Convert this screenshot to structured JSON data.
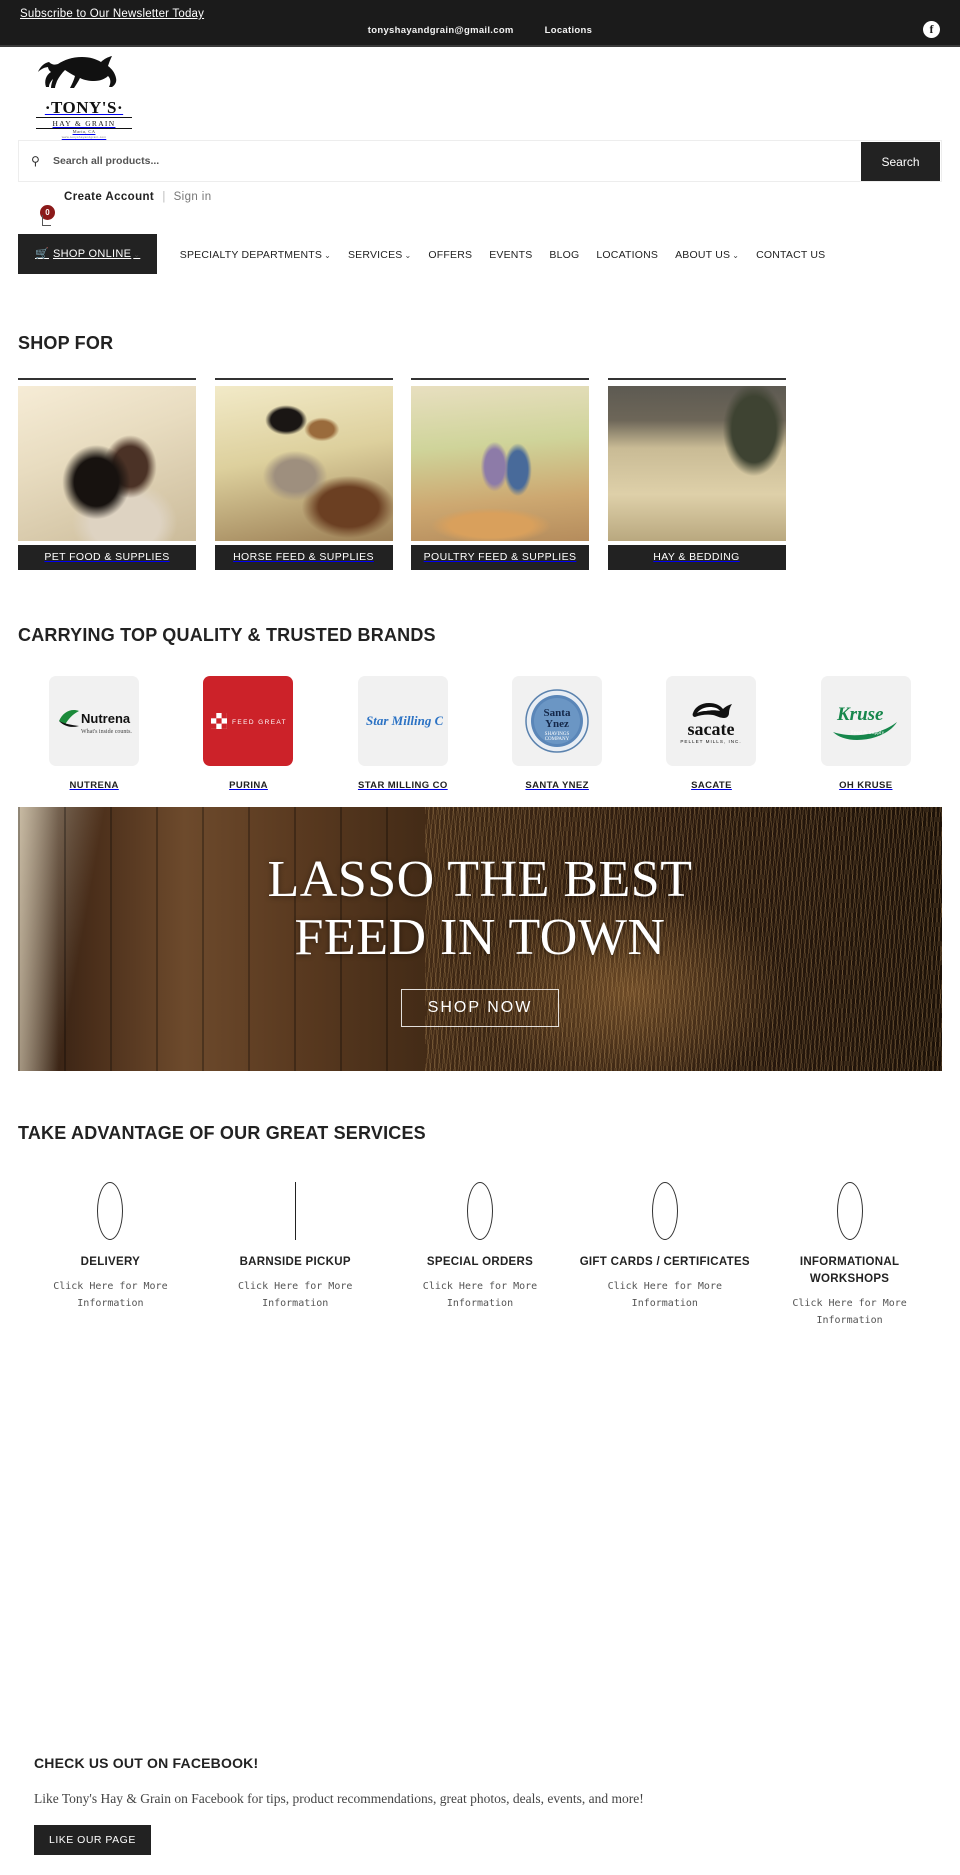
{
  "topbar": {
    "newsletter": "Subscribe to Our Newsletter Today",
    "email": "tonyshayandgrain@gmail.com",
    "locations": "Locations",
    "facebook_icon": "facebook-icon",
    "facebook_glyph": "f"
  },
  "logo": {
    "name": "·TONY'S·",
    "sub": "HAY & GRAIN",
    "city": "Maria, CA",
    "url": "www.tonyshayandgrain.com"
  },
  "search": {
    "placeholder": "Search all products...",
    "value": "",
    "button": "Search",
    "icon": "search-icon"
  },
  "account": {
    "create": "Create Account",
    "separator": "|",
    "signin": "Sign in",
    "cart_count": "0"
  },
  "nav": {
    "primary": {
      "label": "SHOP ONLINE",
      "caret": "⌄",
      "icon": "cart-icon"
    },
    "items": [
      {
        "label": "SPECIALTY DEPARTMENTS",
        "caret": "⌄"
      },
      {
        "label": "SERVICES",
        "caret": "⌄"
      },
      {
        "label": "OFFERS",
        "caret": ""
      },
      {
        "label": "EVENTS",
        "caret": ""
      },
      {
        "label": "BLOG",
        "caret": ""
      },
      {
        "label": "LOCATIONS",
        "caret": ""
      },
      {
        "label": "ABOUT US",
        "caret": "⌄"
      },
      {
        "label": "CONTACT US",
        "caret": ""
      }
    ]
  },
  "shop_for": {
    "heading": "SHOP FOR",
    "cards": [
      {
        "label": "PET FOOD & SUPPLIES",
        "image": "man-hugging-border-collie-dog"
      },
      {
        "label": "HORSE FEED & SUPPLIES",
        "image": "two-riders-on-horseback-in-cowboy-hats"
      },
      {
        "label": "POULTRY FEED & SUPPLIES",
        "image": "two-girls-feeding-chickens"
      },
      {
        "label": "HAY & BEDDING",
        "image": "person-stacking-hay-bales-in-barn"
      }
    ]
  },
  "brands": {
    "heading": "CARRYING TOP QUALITY & TRUSTED BRANDS",
    "items": [
      {
        "name": "NUTRENA",
        "logo_text": "Nutrena",
        "logo_tag": "What's inside counts.",
        "color": "#111111"
      },
      {
        "name": "PURINA",
        "logo_text": "FEED GREATNESS",
        "logo_tag": "",
        "color": "#cc2229"
      },
      {
        "name": "STAR MILLING CO",
        "logo_text": "Star Milling Co.",
        "logo_tag": "",
        "color": "#2b72c4"
      },
      {
        "name": "SANTA YNEZ",
        "logo_text": "Santa Ynez",
        "logo_tag": "SHAVINGS COMPANY",
        "color": "#4a7fb5"
      },
      {
        "name": "SACATE",
        "logo_text": "sacate",
        "logo_tag": "PELLET MILLS, INC.",
        "color": "#111111"
      },
      {
        "name": "OH KRUSE",
        "logo_text": "Kruse",
        "logo_tag": "Feed & Supply",
        "color": "#17874c"
      }
    ]
  },
  "hero": {
    "line1": "LASSO THE BEST",
    "line2": "FEED IN TOWN",
    "button": "SHOP NOW",
    "image": "hay-bales-inside-wooden-barn"
  },
  "services": {
    "heading": "TAKE ADVANTAGE OF OUR GREAT SERVICES",
    "items": [
      {
        "title": "DELIVERY",
        "link": "Click Here for More Information",
        "icon": "truck-icon"
      },
      {
        "title": "BARNSIDE PICKUP",
        "link": "Click Here for More Information",
        "icon": "barn-icon"
      },
      {
        "title": "SPECIAL ORDERS",
        "link": "Click Here for More Information",
        "icon": "clipboard-icon"
      },
      {
        "title": "GIFT CARDS / CERTIFICATES",
        "link": "Click Here for More Information",
        "icon": "gift-card-icon"
      },
      {
        "title": "INFORMATIONAL WORKSHOPS",
        "link": "Click Here for More Information",
        "icon": "workshop-icon"
      }
    ]
  },
  "facebook": {
    "heading": "CHECK US OUT ON FACEBOOK!",
    "text": "Like Tony's Hay & Grain on Facebook for tips, product recommendations, great photos, deals, events, and more!",
    "button": "LIKE OUR PAGE"
  }
}
